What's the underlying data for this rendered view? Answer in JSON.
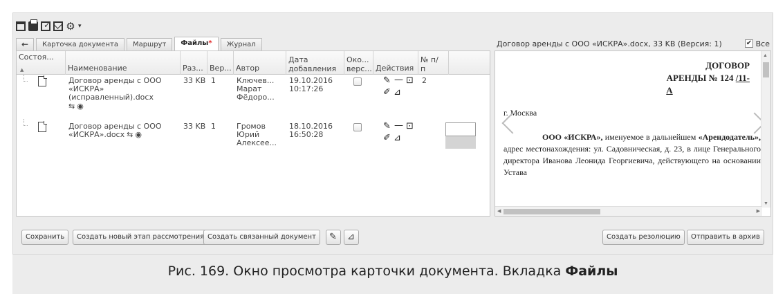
{
  "toolbar": {
    "icons": [
      "window-icon",
      "print-icon",
      "edit-check-icon",
      "mail-icon",
      "settings-icon",
      "dropdown-caret-icon"
    ]
  },
  "tabs": [
    {
      "label": "←"
    },
    {
      "label": "Карточка документа"
    },
    {
      "label": "Маршрут"
    },
    {
      "label": "Файлы",
      "marker": "*",
      "active": true
    },
    {
      "label": "Журнал"
    }
  ],
  "grid": {
    "columns": {
      "state": "Состоя...",
      "name": "Наименование",
      "size": "Раз...",
      "version": "Вер...",
      "author": "Автор",
      "date_line1": "Дата",
      "date_line2": "добавления",
      "final_line1": "Око...",
      "final_line2": "верс...",
      "actions": "Действия",
      "num_line1": "№ п/",
      "num_line2": "п"
    },
    "rows": [
      {
        "name_lines": [
          "Договор аренды с ООО",
          "«ИСКРА»",
          "(исправленный).docx"
        ],
        "size": "33 KB",
        "version": "1",
        "author_lines": [
          "Ключев...",
          "Марат",
          "Фёдоро..."
        ],
        "date": "19.10.2016",
        "time": "10:17:26",
        "num": "2"
      },
      {
        "name_lines": [
          "Договор аренды с ООО",
          "«ИСКРА».docx"
        ],
        "size": "33 KB",
        "version": "1",
        "author_lines": [
          "Громов",
          "Юрий",
          "Алексее..."
        ],
        "date": "18.10.2016",
        "time": "16:50:28",
        "num": ""
      }
    ]
  },
  "preview": {
    "header": "Договор аренды с ООО «ИСКРА».docx, 33 KB (Версия: 1)",
    "all_checked": true,
    "all_label": "Все",
    "title_line1": "ДОГОВОР",
    "title_line2": "АРЕНДЫ № 124 ",
    "title_link": "/11-",
    "title_line3": "А",
    "city": "г. Москва",
    "body_bold1": "ООО «ИСКРА»,",
    "body_text1": " именуемое в дальнейшем ",
    "body_bold2": "«Арендодатель»,",
    "body_text2": " адрес местонахождения: ул. Садовническая, д. 23, в лице Генерального директора Иванова Леонида Георгиевича, действующего на основании Устава"
  },
  "buttons": {
    "save": "Сохранить",
    "new_stage": "Создать новый этап рассмотрения",
    "linked_doc": "Создать связанный документ",
    "create_resolution": "Создать резолюцию",
    "send_archive": "Отправить в архив"
  },
  "caption": {
    "text": "Рис. 169. Окно просмотра карточки документа. Вкладка ",
    "bold": "Файлы"
  }
}
